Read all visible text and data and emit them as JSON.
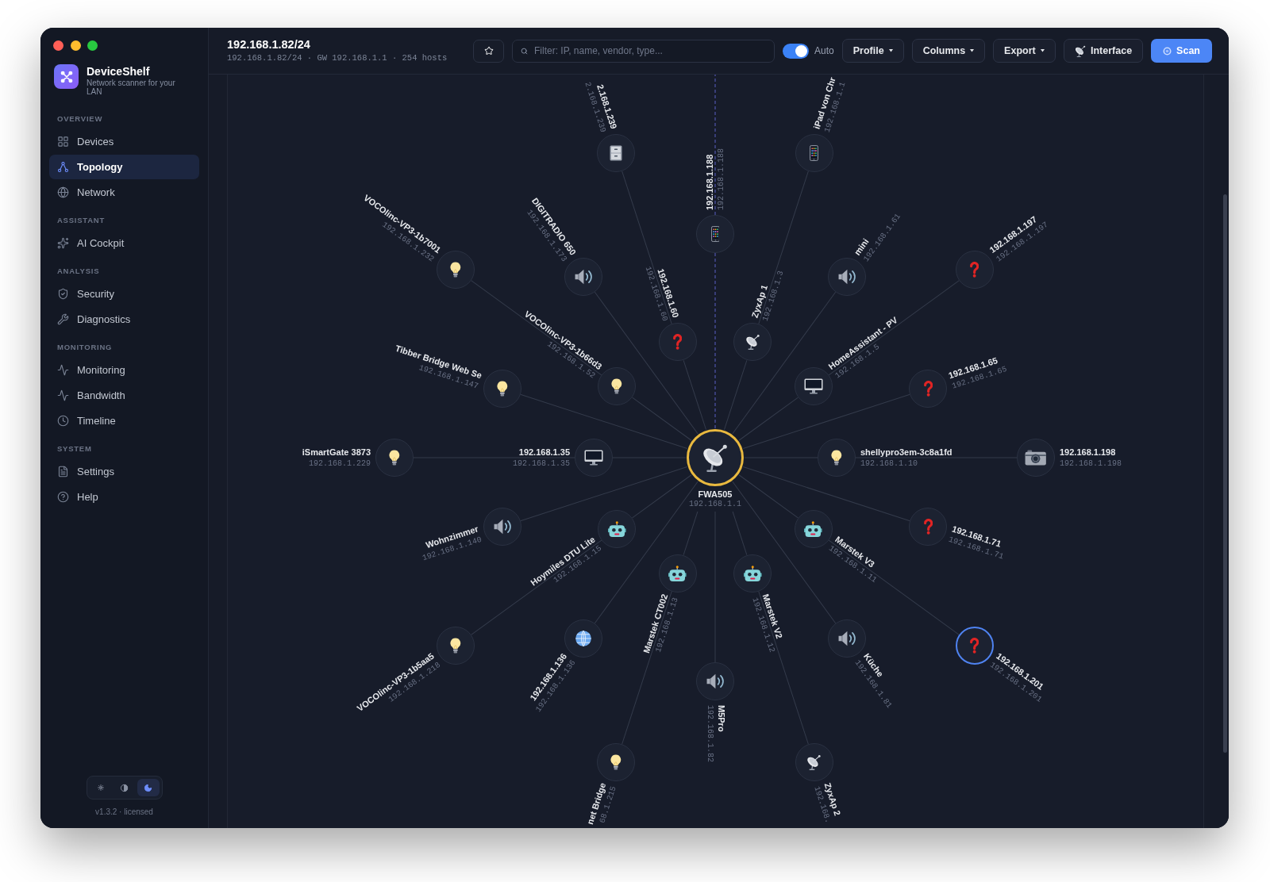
{
  "window": {
    "controls": [
      {
        "color": "#ff5f57"
      },
      {
        "color": "#febc2e"
      },
      {
        "color": "#28c840"
      }
    ]
  },
  "sidebar": {
    "app_name": "DeviceShelf",
    "tagline": "Network scanner for your LAN",
    "sections": [
      {
        "heading": "OVERVIEW",
        "items": [
          {
            "label": "Devices",
            "selected": false
          },
          {
            "label": "Topology",
            "selected": true
          },
          {
            "label": "Network",
            "selected": false
          }
        ]
      },
      {
        "heading": "ASSISTANT",
        "items": [
          {
            "label": "AI Cockpit",
            "selected": false
          }
        ]
      },
      {
        "heading": "ANALYSIS",
        "items": [
          {
            "label": "Security",
            "selected": false
          },
          {
            "label": "Diagnostics",
            "selected": false
          }
        ]
      },
      {
        "heading": "MONITORING",
        "items": [
          {
            "label": "Monitoring",
            "selected": false
          },
          {
            "label": "Bandwidth",
            "selected": false
          },
          {
            "label": "Timeline",
            "selected": false
          }
        ]
      },
      {
        "heading": "SYSTEM",
        "items": [
          {
            "label": "Settings",
            "selected": false
          },
          {
            "label": "Help",
            "selected": false
          }
        ]
      }
    ],
    "theme_switch": [
      {
        "kind": "light",
        "selected": false
      },
      {
        "kind": "system",
        "selected": false
      },
      {
        "kind": "dark",
        "selected": true
      }
    ],
    "version": "v1.3.2 · licensed"
  },
  "header": {
    "title": "192.168.1.82/24",
    "subtitle": "192.168.1.82/24 · GW 192.168.1.1 · 254 hosts",
    "search": {
      "placeholder": "Filter: IP, name, vendor, type..."
    },
    "auto_toggle": {
      "label": "Auto",
      "on": true
    },
    "buttons": [
      {
        "label": "Profile",
        "kind": "menu"
      },
      {
        "label": "Columns",
        "kind": "menu"
      },
      {
        "label": "Export",
        "kind": "menu"
      },
      {
        "label": "Interface",
        "kind": "tool"
      },
      {
        "label": "Scan",
        "kind": "primary"
      }
    ]
  },
  "topology": {
    "hub": {
      "name": "FWA505",
      "ip": "192.168.1.1",
      "kind": "accesspoint"
    },
    "rings": [
      {
        "nodes": [
          {
            "name": "192.168.1.60",
            "ip": "192.168.1.60",
            "kind": "unknown",
            "selected": false,
            "dashed": false
          },
          {
            "name": "ZyxAp 1",
            "ip": "192.168.1.3",
            "kind": "accesspoint",
            "selected": false,
            "dashed": false
          },
          {
            "name": "VOCOlinc-VP3-1b66d3",
            "ip": "192.168.1.52",
            "kind": "light",
            "selected": false,
            "dashed": false
          },
          {
            "name": "HomeAssistant - PV",
            "ip": "192.168.1.5",
            "kind": "computer",
            "selected": false,
            "dashed": false
          },
          {
            "name": "192.168.1.35",
            "ip": "192.168.1.35",
            "kind": "computer",
            "selected": false,
            "dashed": false
          },
          {
            "name": "shellypro3em-3c8a1fd",
            "ip": "192.168.1.10",
            "kind": "light",
            "selected": false,
            "dashed": false
          },
          {
            "name": "Hoymiles DTU Lite",
            "ip": "192.168.1.15",
            "kind": "bot",
            "selected": false,
            "dashed": false
          },
          {
            "name": "Marstek V3",
            "ip": "192.168.1.11",
            "kind": "bot",
            "selected": false,
            "dashed": false
          },
          {
            "name": "Marstek CT002",
            "ip": "192.168.1.13",
            "kind": "bot",
            "selected": false,
            "dashed": false
          },
          {
            "name": "Marstek V2",
            "ip": "192.168.1.12",
            "kind": "bot",
            "selected": false,
            "dashed": false
          }
        ]
      },
      {
        "nodes": [
          {
            "name": "192.168.1.188",
            "ip": "192.168.1.188",
            "kind": "phone",
            "selected": false,
            "dashed": true
          },
          {
            "name": "DIGITRADIO 650",
            "ip": "192.168.1.173",
            "kind": "speaker",
            "selected": false,
            "dashed": false
          },
          {
            "name": "mini",
            "ip": "192.168.1.61",
            "kind": "speaker",
            "selected": false,
            "dashed": false
          },
          {
            "name": "Tibber Bridge Web Se",
            "ip": "192.168.1.147",
            "kind": "light",
            "selected": false,
            "dashed": false
          },
          {
            "name": "192.168.1.65",
            "ip": "192.168.1.65",
            "kind": "unknown",
            "selected": false,
            "dashed": false
          },
          {
            "name": "Wohnzimmer",
            "ip": "192.168.1.140",
            "kind": "speaker",
            "selected": false,
            "dashed": false
          },
          {
            "name": "192.168.1.71",
            "ip": "192.168.1.71",
            "kind": "unknown",
            "selected": false,
            "dashed": false
          },
          {
            "name": "192.168.1.136",
            "ip": "192.168.1.136",
            "kind": "web",
            "selected": false,
            "dashed": false
          },
          {
            "name": "Küche",
            "ip": "192.168.1.81",
            "kind": "speaker",
            "selected": false,
            "dashed": false
          },
          {
            "name": "M5Pro",
            "ip": "192.168.1.82",
            "kind": "speaker",
            "selected": false,
            "dashed": false
          }
        ]
      },
      {
        "nodes": [
          {
            "name": "2.168.1.239",
            "ip": "2.168.1.239",
            "kind": "storage",
            "selected": false,
            "dashed": false
          },
          {
            "name": "iPad von Chr",
            "ip": "192.168.1.1",
            "kind": "phone",
            "selected": false,
            "dashed": false
          },
          {
            "name": "VOCOlinc-VP3-1b7001",
            "ip": "192.168.1.232",
            "kind": "light",
            "selected": false,
            "dashed": false
          },
          {
            "name": "192.168.1.197",
            "ip": "192.168.1.197",
            "kind": "unknown",
            "selected": false,
            "dashed": false
          },
          {
            "name": "iSmartGate 3873",
            "ip": "192.168.1.229",
            "kind": "light",
            "selected": false,
            "dashed": false
          },
          {
            "name": "192.168.1.198",
            "ip": "192.168.1.198",
            "kind": "camera",
            "selected": false,
            "dashed": false
          },
          {
            "name": "VOCOlinc-VP3-1b5aa5",
            "ip": "192.168.1.218",
            "kind": "light",
            "selected": false,
            "dashed": false
          },
          {
            "name": "192.168.1.201",
            "ip": "192.168.1.201",
            "kind": "unknown",
            "selected": true,
            "dashed": false
          },
          {
            "name": "net Bridge",
            "ip": "68.1.215",
            "kind": "light",
            "selected": false,
            "dashed": false
          },
          {
            "name": "ZyxAp 2",
            "ip": "192.168.",
            "kind": "accesspoint",
            "selected": false,
            "dashed": false
          }
        ]
      }
    ]
  }
}
